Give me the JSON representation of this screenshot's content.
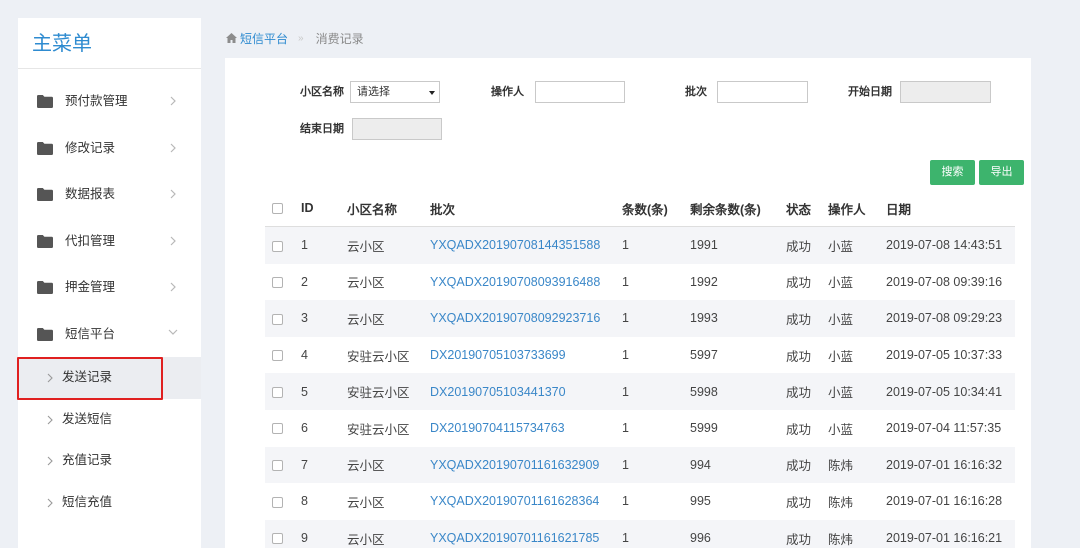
{
  "colors": {
    "accent": "#2e8bd0",
    "link": "#3a87c8",
    "button": "#3db46d",
    "highlight": "#e02020",
    "stripe": "#f4f5f8",
    "page-bg": "#edf0f5"
  },
  "sidebar": {
    "title": "主菜单",
    "items": [
      {
        "label": "预付款管理",
        "icon": "folder-icon",
        "chevron": "chevron-right-icon"
      },
      {
        "label": "修改记录",
        "icon": "folder-icon",
        "chevron": "chevron-right-icon"
      },
      {
        "label": "数据报表",
        "icon": "folder-icon",
        "chevron": "chevron-right-icon"
      },
      {
        "label": "代扣管理",
        "icon": "folder-icon",
        "chevron": "chevron-right-icon"
      },
      {
        "label": "押金管理",
        "icon": "folder-icon",
        "chevron": "chevron-right-icon"
      },
      {
        "label": "短信平台",
        "icon": "folder-icon",
        "chevron": "chevron-down-icon",
        "expanded": true
      }
    ],
    "subitems": [
      {
        "label": "发送记录",
        "icon": "chevron-right-icon",
        "selected": true
      },
      {
        "label": "发送短信",
        "icon": "chevron-right-icon"
      },
      {
        "label": "充值记录",
        "icon": "chevron-right-icon"
      },
      {
        "label": "短信充值",
        "icon": "chevron-right-icon"
      }
    ]
  },
  "breadcrumb": {
    "icon": "home-icon",
    "parent": "短信平台",
    "separator": "»",
    "current": "消费记录"
  },
  "filters": {
    "community": {
      "label": "小区名称",
      "selected": "请选择"
    },
    "operator": {
      "label": "操作人",
      "value": ""
    },
    "batch": {
      "label": "批次",
      "value": ""
    },
    "start_date": {
      "label": "开始日期",
      "value": ""
    },
    "end_date": {
      "label": "结束日期",
      "value": ""
    }
  },
  "actions": {
    "search": "搜索",
    "export": "导出"
  },
  "table": {
    "columns": [
      "ID",
      "小区名称",
      "批次",
      "条数(条)",
      "剩余条数(条)",
      "状态",
      "操作人",
      "日期"
    ],
    "rows": [
      {
        "id": 1,
        "community": "云小区",
        "batch": "YXQADX20190708144351588",
        "count": 1,
        "remaining": 1991,
        "status": "成功",
        "operator": "小蓝",
        "date": "2019-07-08 14:43:51"
      },
      {
        "id": 2,
        "community": "云小区",
        "batch": "YXQADX20190708093916488",
        "count": 1,
        "remaining": 1992,
        "status": "成功",
        "operator": "小蓝",
        "date": "2019-07-08 09:39:16"
      },
      {
        "id": 3,
        "community": "云小区",
        "batch": "YXQADX20190708092923716",
        "count": 1,
        "remaining": 1993,
        "status": "成功",
        "operator": "小蓝",
        "date": "2019-07-08 09:29:23"
      },
      {
        "id": 4,
        "community": "安驻云小区",
        "batch": "DX20190705103733699",
        "count": 1,
        "remaining": 5997,
        "status": "成功",
        "operator": "小蓝",
        "date": "2019-07-05 10:37:33"
      },
      {
        "id": 5,
        "community": "安驻云小区",
        "batch": "DX20190705103441370",
        "count": 1,
        "remaining": 5998,
        "status": "成功",
        "operator": "小蓝",
        "date": "2019-07-05 10:34:41"
      },
      {
        "id": 6,
        "community": "安驻云小区",
        "batch": "DX20190704115734763",
        "count": 1,
        "remaining": 5999,
        "status": "成功",
        "operator": "小蓝",
        "date": "2019-07-04 11:57:35"
      },
      {
        "id": 7,
        "community": "云小区",
        "batch": "YXQADX20190701161632909",
        "count": 1,
        "remaining": 994,
        "status": "成功",
        "operator": "陈炜",
        "date": "2019-07-01 16:16:32"
      },
      {
        "id": 8,
        "community": "云小区",
        "batch": "YXQADX20190701161628364",
        "count": 1,
        "remaining": 995,
        "status": "成功",
        "operator": "陈炜",
        "date": "2019-07-01 16:16:28"
      },
      {
        "id": 9,
        "community": "云小区",
        "batch": "YXQADX20190701161621785",
        "count": 1,
        "remaining": 996,
        "status": "成功",
        "operator": "陈炜",
        "date": "2019-07-01 16:16:21"
      }
    ]
  }
}
